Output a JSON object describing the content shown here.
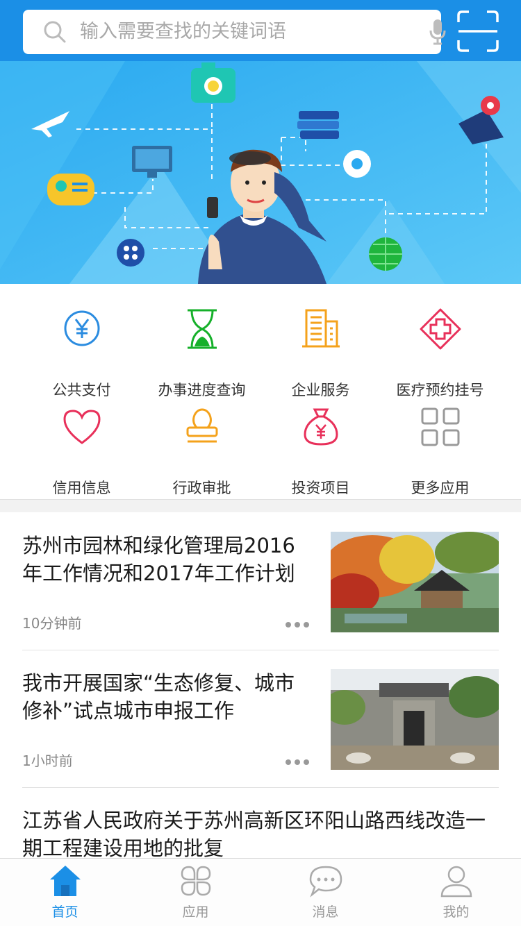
{
  "colors": {
    "header": "#1b8fe6",
    "accent": "#1b8fe6",
    "banner": "#43b8f5"
  },
  "search": {
    "placeholder": "输入需要查找的关键词语",
    "icon": "search-icon",
    "voice_icon": "microphone-icon",
    "scan_icon": "scan-icon"
  },
  "banner": {
    "slides": 3,
    "active": 1
  },
  "services": [
    {
      "label": "公共支付",
      "icon": "yuan-coin-icon",
      "color": "#2b8ce0"
    },
    {
      "label": "办事进度查询",
      "icon": "hourglass-icon",
      "color": "#16b02a"
    },
    {
      "label": "企业服务",
      "icon": "building-icon",
      "color": "#f4a21b"
    },
    {
      "label": "医疗预约挂号",
      "icon": "medical-cross-icon",
      "color": "#e8305a"
    },
    {
      "label": "信用信息",
      "icon": "heart-icon",
      "color": "#e8305a"
    },
    {
      "label": "行政审批",
      "icon": "stamp-icon",
      "color": "#f4a21b"
    },
    {
      "label": "投资项目",
      "icon": "money-bag-icon",
      "color": "#e8305a"
    },
    {
      "label": "更多应用",
      "icon": "grid-more-icon",
      "color": "#999999"
    }
  ],
  "news": [
    {
      "title": "苏州市园林和绿化管理局2016年工作情况和2017年工作计划",
      "time": "10分钟前"
    },
    {
      "title": "我市开展国家“生态修复、城市修补”试点城市申报工作",
      "time": "1小时前"
    },
    {
      "title": "江苏省人民政府关于苏州高新区环阳山路西线改造一期工程建设用地的批复"
    }
  ],
  "tabs": [
    {
      "label": "首页",
      "icon": "home-icon",
      "active": true
    },
    {
      "label": "应用",
      "icon": "apps-icon",
      "active": false
    },
    {
      "label": "消息",
      "icon": "message-icon",
      "active": false
    },
    {
      "label": "我的",
      "icon": "profile-icon",
      "active": false
    }
  ]
}
